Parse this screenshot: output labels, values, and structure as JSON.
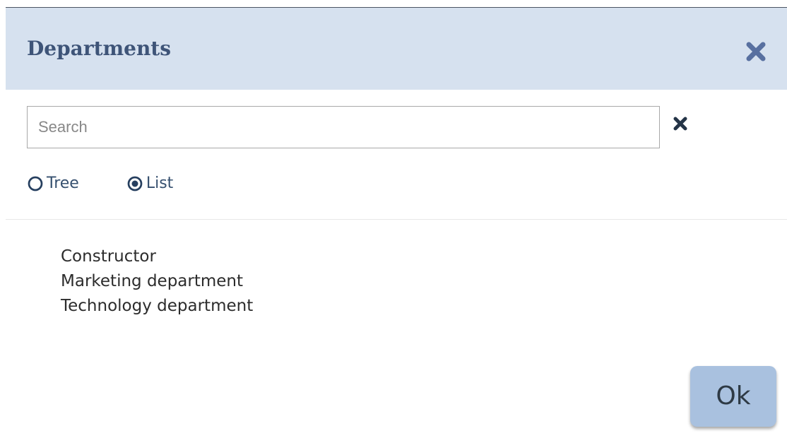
{
  "dialog": {
    "title": "Departments",
    "colors": {
      "header_background": "#d6e1ef",
      "title_text": "#3e5478",
      "icon_blue": "#5870a0",
      "clear_icon": "#243447",
      "ok_button": "#a9c1df"
    },
    "close_icon": "close-icon"
  },
  "search": {
    "placeholder": "Search",
    "value": "",
    "clear_icon": "clear-search-icon"
  },
  "view_options": [
    {
      "label": "Tree",
      "selected": false,
      "icon": "radio-unselected-icon"
    },
    {
      "label": "List",
      "selected": true,
      "icon": "radio-selected-icon"
    }
  ],
  "departments": [
    "Constructor",
    "Marketing department",
    "Technology department"
  ],
  "actions": {
    "ok_label": "Ok"
  }
}
